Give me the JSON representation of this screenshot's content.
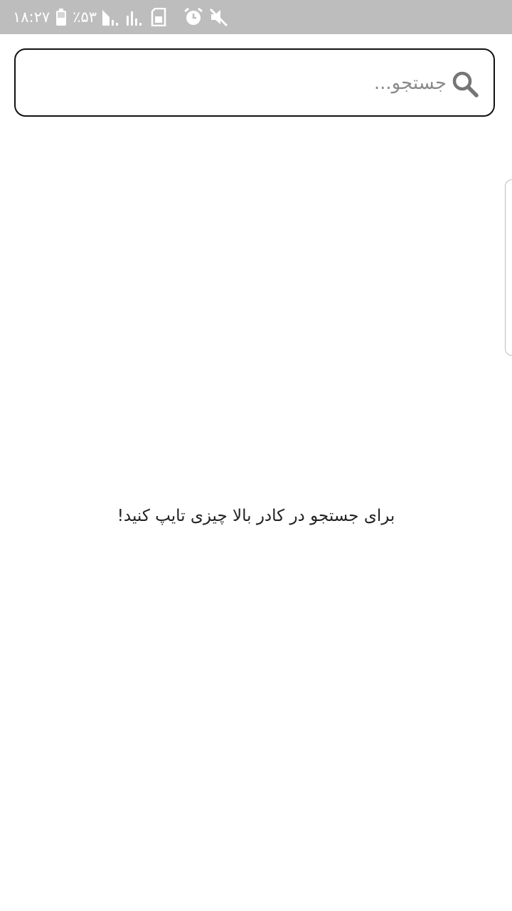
{
  "status_bar": {
    "time": "۱۸:۲۷",
    "battery_percent": "٪۵۳",
    "background_color": "#bdbdbd",
    "icons": [
      "battery-icon",
      "signal-icon",
      "signal-icon",
      "sim-icon",
      "alarm-icon",
      "mute-icon"
    ]
  },
  "search": {
    "placeholder": "جستجو...",
    "value": "",
    "icon": "search-icon"
  },
  "main": {
    "empty_message": "برای جستجو در کادر بالا چیزی تایپ کنید!"
  },
  "colors": {
    "border": "#111111",
    "placeholder": "#8a8a8a",
    "icon": "#757575"
  }
}
